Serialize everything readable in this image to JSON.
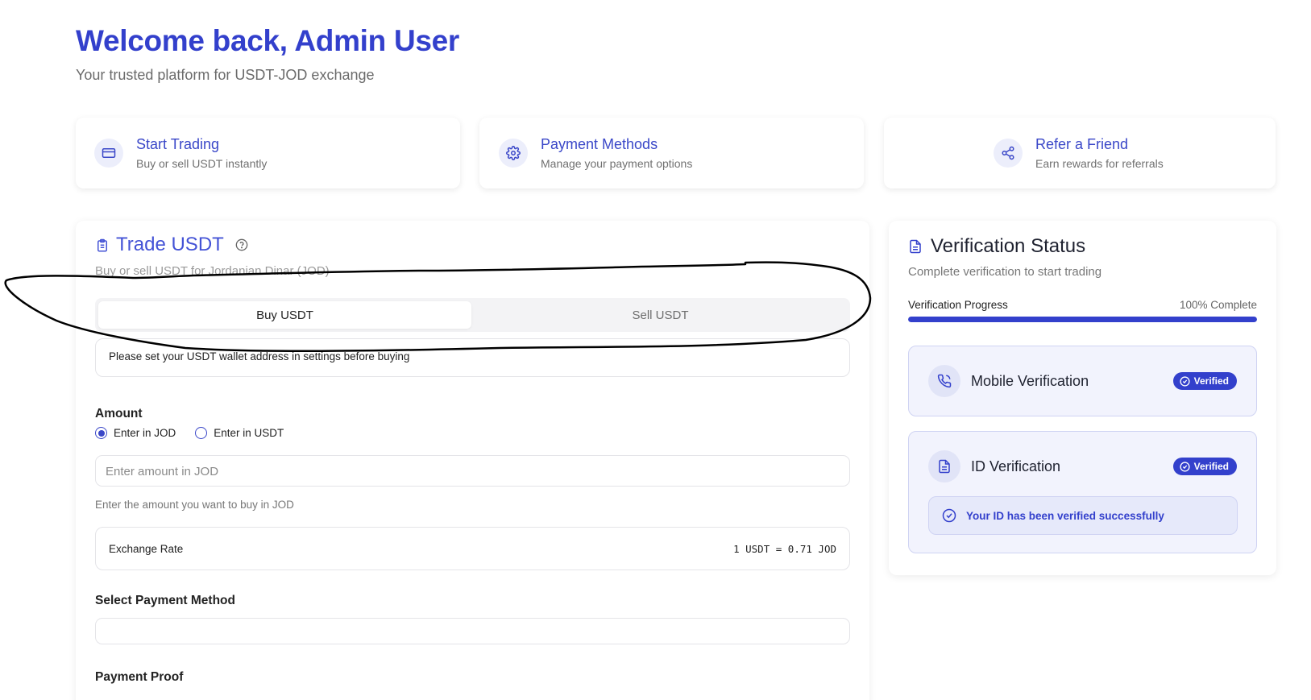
{
  "header": {
    "title": "Welcome back, Admin User",
    "subtitle": "Your trusted platform for USDT-JOD exchange"
  },
  "quick_actions": [
    {
      "title": "Start Trading",
      "subtitle": "Buy or sell USDT instantly",
      "icon": "credit-card-icon"
    },
    {
      "title": "Payment Methods",
      "subtitle": "Manage your payment options",
      "icon": "gear-icon"
    },
    {
      "title": "Refer a Friend",
      "subtitle": "Earn rewards for referrals",
      "icon": "share-icon"
    }
  ],
  "trade": {
    "title": "Trade USDT",
    "subtitle": "Buy or sell USDT for Jordanian Dinar (JOD)",
    "tabs": [
      "Buy USDT",
      "Sell USDT"
    ],
    "active_tab": "Buy USDT",
    "wallet_notice": "Please set your USDT wallet address in settings before buying",
    "amount_label": "Amount",
    "radio_options": [
      "Enter in JOD",
      "Enter in USDT"
    ],
    "radio_selected": "Enter in JOD",
    "amount_placeholder": "Enter amount in JOD",
    "amount_hint": "Enter the amount you want to buy in JOD",
    "rate_label": "Exchange Rate",
    "rate_value": "1 USDT = 0.71 JOD",
    "payment_method_label": "Select Payment Method",
    "payment_proof_label": "Payment Proof"
  },
  "verification": {
    "title": "Verification Status",
    "subtitle": "Complete verification to start trading",
    "progress_label": "Verification Progress",
    "progress_text": "100% Complete",
    "progress_value": 1.0,
    "items": [
      {
        "name": "Mobile Verification",
        "badge": "Verified",
        "icon": "phone-icon"
      },
      {
        "name": "ID Verification",
        "badge": "Verified",
        "icon": "document-icon"
      }
    ],
    "id_success_message": "Your ID has been verified successfully"
  },
  "colors": {
    "accent": "#3340cc",
    "card_tint": "#f2f3fd"
  }
}
